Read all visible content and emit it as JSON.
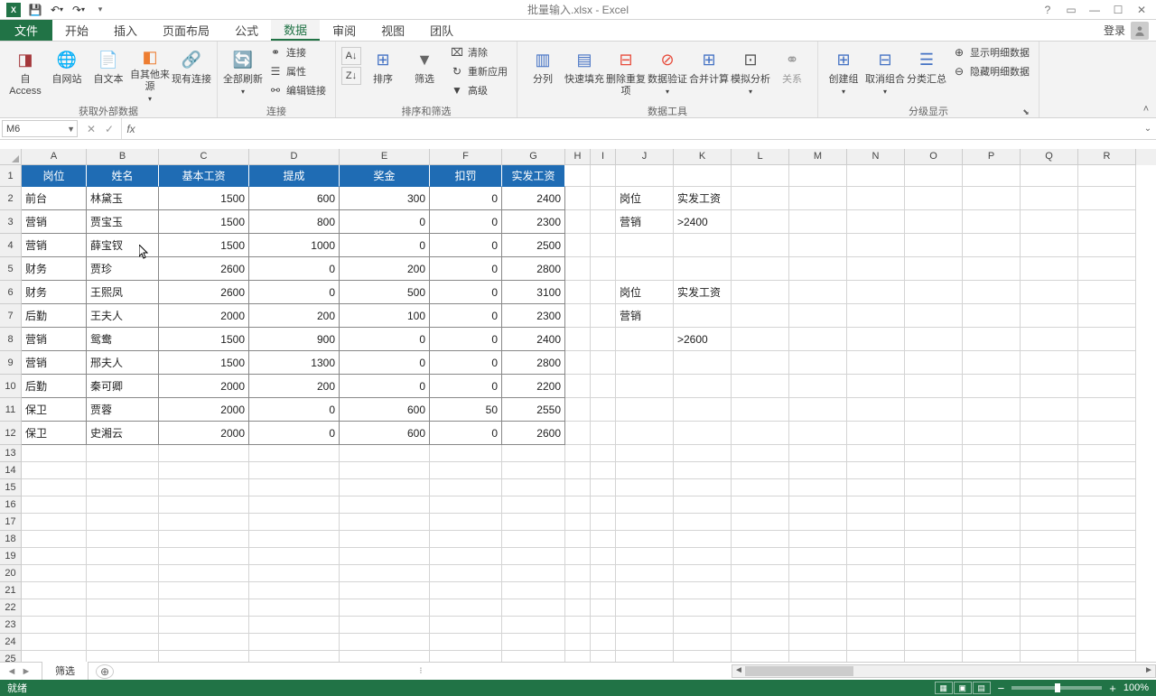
{
  "titlebar": {
    "title": "批量输入.xlsx - Excel"
  },
  "tabs": {
    "file": "文件",
    "list": [
      "开始",
      "插入",
      "页面布局",
      "公式",
      "数据",
      "审阅",
      "视图",
      "团队"
    ],
    "active_index": 4
  },
  "login": "登录",
  "ribbon": {
    "groups": {
      "external": {
        "label": "获取外部数据",
        "access": "自 Access",
        "web": "自网站",
        "text": "自文本",
        "other": "自其他来源",
        "existing": "现有连接"
      },
      "connections": {
        "label": "连接",
        "refresh": "全部刷新",
        "conn": "连接",
        "prop": "属性",
        "editlink": "编辑链接"
      },
      "sortfilter": {
        "label": "排序和筛选",
        "sort": "排序",
        "filter": "筛选",
        "clear": "清除",
        "reapply": "重新应用",
        "advanced": "高级"
      },
      "datatools": {
        "label": "数据工具",
        "split": "分列",
        "flash": "快速填充",
        "dedup": "删除重复项",
        "validate": "数据验证",
        "merge": "合并计算",
        "analyze": "模拟分析",
        "relation": "关系"
      },
      "outline": {
        "label": "分级显示",
        "group": "创建组",
        "ungroup": "取消组合",
        "subtotal": "分类汇总",
        "showdetail": "显示明细数据",
        "hidedetail": "隐藏明细数据"
      }
    }
  },
  "formula_bar": {
    "namebox": "M6",
    "formula": ""
  },
  "columns": [
    "A",
    "B",
    "C",
    "D",
    "E",
    "F",
    "G",
    "H",
    "I",
    "J",
    "K",
    "L",
    "M",
    "N",
    "O",
    "P",
    "Q",
    "R"
  ],
  "col_widths": {
    "A": 72,
    "B": 80,
    "C": 100,
    "D": 100,
    "E": 100,
    "F": 80,
    "G": 70,
    "H": 28,
    "I": 28,
    "J": 64,
    "K": 64,
    "L": 64,
    "M": 64,
    "N": 64,
    "O": 64,
    "P": 64,
    "Q": 64,
    "R": 64
  },
  "table_headers": [
    "岗位",
    "姓名",
    "基本工资",
    "提成",
    "奖金",
    "扣罚",
    "实发工资"
  ],
  "table_data": [
    {
      "A": "前台",
      "B": "林黛玉",
      "C": "1500",
      "D": "600",
      "E": "300",
      "F": "0",
      "G": "2400"
    },
    {
      "A": "营销",
      "B": "贾宝玉",
      "C": "1500",
      "D": "800",
      "E": "0",
      "F": "0",
      "G": "2300"
    },
    {
      "A": "营销",
      "B": "薛宝钗",
      "C": "1500",
      "D": "1000",
      "E": "0",
      "F": "0",
      "G": "2500"
    },
    {
      "A": "财务",
      "B": "贾珍",
      "C": "2600",
      "D": "0",
      "E": "200",
      "F": "0",
      "G": "2800"
    },
    {
      "A": "财务",
      "B": "王熙凤",
      "C": "2600",
      "D": "0",
      "E": "500",
      "F": "0",
      "G": "3100"
    },
    {
      "A": "后勤",
      "B": "王夫人",
      "C": "2000",
      "D": "200",
      "E": "100",
      "F": "0",
      "G": "2300"
    },
    {
      "A": "营销",
      "B": "鸳鸯",
      "C": "1500",
      "D": "900",
      "E": "0",
      "F": "0",
      "G": "2400"
    },
    {
      "A": "营销",
      "B": "邢夫人",
      "C": "1500",
      "D": "1300",
      "E": "0",
      "F": "0",
      "G": "2800"
    },
    {
      "A": "后勤",
      "B": "秦可卿",
      "C": "2000",
      "D": "200",
      "E": "0",
      "F": "0",
      "G": "2200"
    },
    {
      "A": "保卫",
      "B": "贾蓉",
      "C": "2000",
      "D": "0",
      "E": "600",
      "F": "50",
      "G": "2550"
    },
    {
      "A": "保卫",
      "B": "史湘云",
      "C": "2000",
      "D": "0",
      "E": "600",
      "F": "0",
      "G": "2600"
    }
  ],
  "side_data": {
    "r2": {
      "J": "岗位",
      "K": "实发工资"
    },
    "r3": {
      "J": "营销",
      "K": ">2400"
    },
    "r6": {
      "J": "岗位",
      "K": "实发工资"
    },
    "r7": {
      "J": "营销"
    },
    "r8": {
      "K": ">2600"
    }
  },
  "sheets": {
    "active": "筛选"
  },
  "statusbar": {
    "ready": "就绪",
    "zoom": "100%"
  }
}
